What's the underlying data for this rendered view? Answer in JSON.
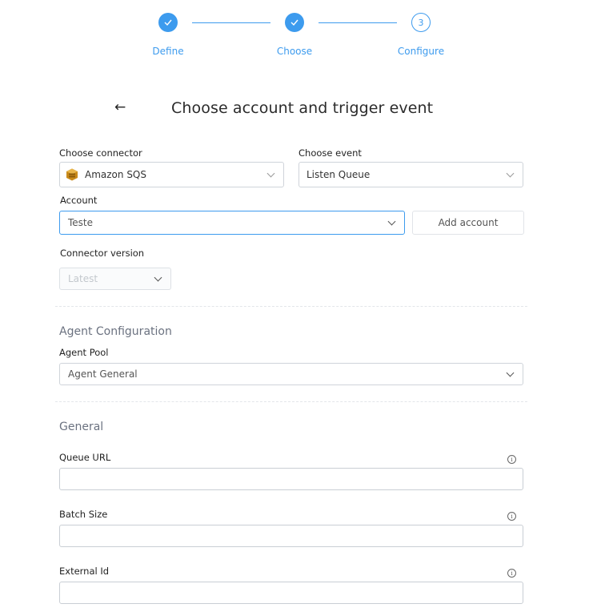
{
  "stepper": {
    "steps": [
      {
        "label": "Define",
        "state": "done"
      },
      {
        "label": "Choose",
        "state": "done"
      },
      {
        "label": "Configure",
        "state": "current",
        "number": "3"
      }
    ],
    "accent_color": "#3d9bee"
  },
  "header": {
    "back_icon": "←",
    "title": "Choose account and trigger event"
  },
  "form": {
    "connector": {
      "label": "Choose connector",
      "value": "Amazon SQS",
      "icon": "amazon-sqs-icon"
    },
    "event": {
      "label": "Choose event",
      "value": "Listen Queue"
    },
    "account": {
      "label": "Account",
      "value": "Teste",
      "add_button": "Add account"
    },
    "connector_version": {
      "label": "Connector version",
      "value": "Latest"
    }
  },
  "agent_configuration": {
    "title": "Agent Configuration",
    "agent_pool": {
      "label": "Agent Pool",
      "value": "Agent General"
    }
  },
  "general": {
    "title": "General",
    "fields": [
      {
        "label": "Queue URL",
        "value": "",
        "info": "i"
      },
      {
        "label": "Batch Size",
        "value": "",
        "info": "i"
      },
      {
        "label": "External Id",
        "value": "",
        "info": "i"
      }
    ]
  }
}
